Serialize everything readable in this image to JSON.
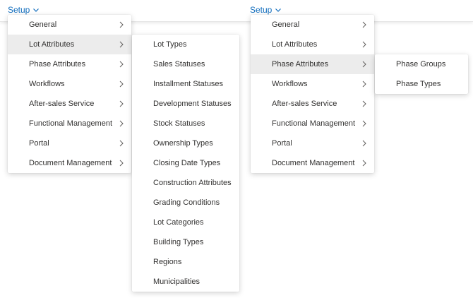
{
  "setup": {
    "label": "Setup"
  },
  "main_menu_items": [
    "General",
    "Lot Attributes",
    "Phase Attributes",
    "Workflows",
    "After-sales Service",
    "Functional Management",
    "Portal",
    "Document Management"
  ],
  "lot_attributes_submenu": [
    "Lot Types",
    "Sales Statuses",
    "Installment Statuses",
    "Development Statuses",
    "Stock Statuses",
    "Ownership Types",
    "Closing Date Types",
    "Construction Attributes",
    "Grading Conditions",
    "Lot Categories",
    "Building Types",
    "Regions",
    "Municipalities"
  ],
  "phase_attributes_submenu": [
    "Phase Groups",
    "Phase Types"
  ],
  "colors": {
    "link": "#0f6cbd",
    "hover_bg": "#ececec",
    "text": "#323130"
  }
}
